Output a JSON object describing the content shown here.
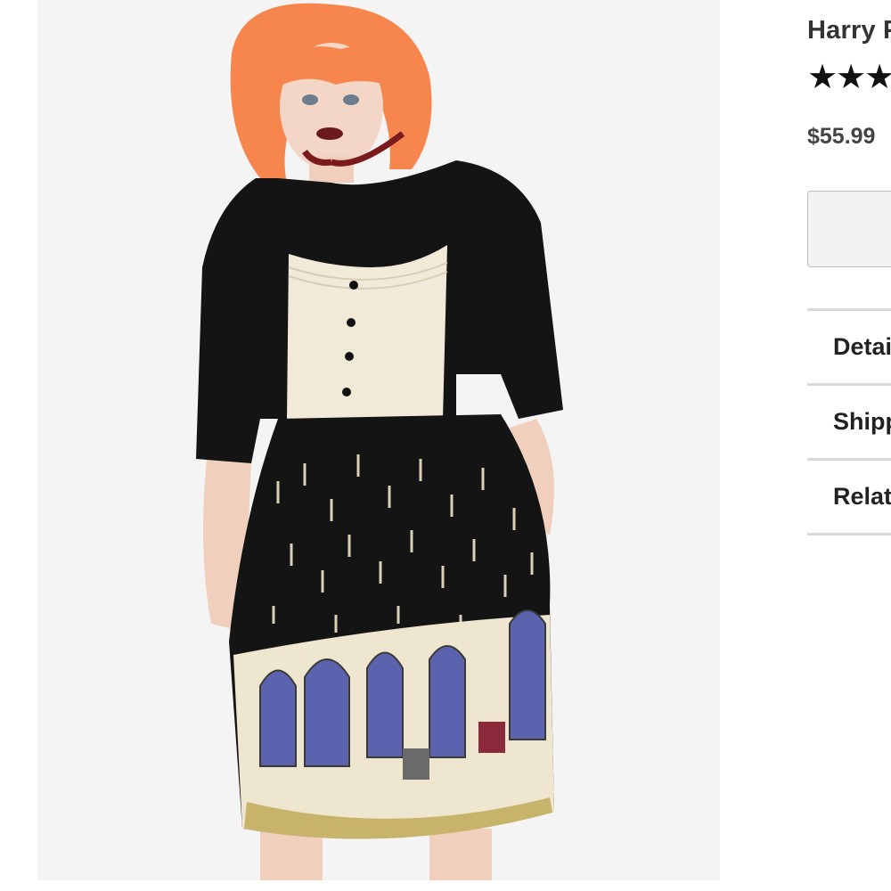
{
  "product": {
    "title": "Harry P",
    "rating_stars": "★★★",
    "rating_value": 3,
    "price": "$55.99",
    "image_alt_icon": "product-photo"
  },
  "accordion": {
    "items": [
      {
        "label": "Detai"
      },
      {
        "label": "Shipp"
      },
      {
        "label": "Relat"
      }
    ]
  },
  "colors": {
    "photo_bg": "#f4f4f4",
    "hair": "#f7864e",
    "dress_black": "#141414",
    "bodice_cream": "#f2ead8",
    "window_blue": "#5b63ae",
    "divider": "#d9d9d9"
  }
}
